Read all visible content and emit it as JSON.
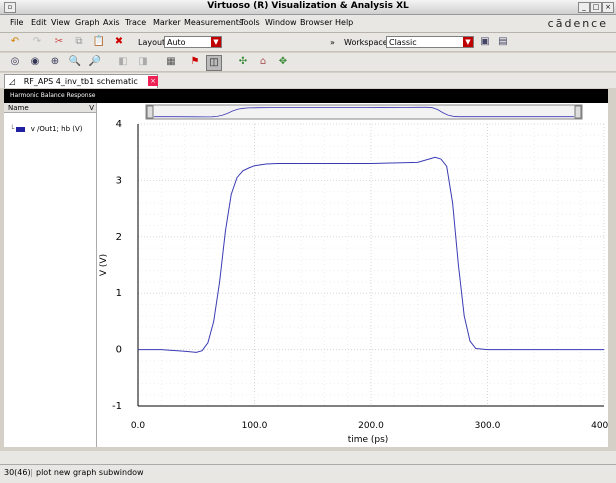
{
  "window": {
    "title": "Virtuoso (R) Visualization & Analysis XL"
  },
  "menu": [
    "File",
    "Edit",
    "View",
    "Graph",
    "Axis",
    "Trace",
    "Marker",
    "Measurements",
    "Tools",
    "Window",
    "Browser",
    "Help"
  ],
  "brand": "cādence",
  "toolbar": {
    "layout_label": "Layout:",
    "layout_value": "Auto",
    "workspace_label": "Workspace:",
    "workspace_value": "Classic"
  },
  "tab": {
    "label": "RF_APS 4_inv_tb1 schematic"
  },
  "graph": {
    "title": "Harmonic Balance Response"
  },
  "legend": {
    "header": "Name",
    "header_v": "V",
    "trace": "v /Out1; hb (V)"
  },
  "status": {
    "count": "30(46)",
    "message": "plot new graph subwindow"
  },
  "colors": {
    "trace": "#3b3bb5",
    "grid": "#d8d8d8"
  },
  "chart_data": {
    "type": "line",
    "xlabel": "time (ps)",
    "ylabel": "V (V)",
    "xlim": [
      0,
      400
    ],
    "ylim": [
      -1,
      4
    ],
    "xticks": [
      "0.0",
      "100.0",
      "200.0",
      "300.0",
      "400.0"
    ],
    "yticks": [
      "4",
      "3",
      "2",
      "1",
      "0",
      "-1"
    ],
    "grid": true,
    "series": [
      {
        "name": "v /Out1; hb (V)",
        "x": [
          0,
          20,
          40,
          50,
          55,
          60,
          65,
          70,
          75,
          80,
          85,
          90,
          95,
          100,
          110,
          120,
          150,
          200,
          240,
          250,
          255,
          260,
          265,
          270,
          275,
          280,
          285,
          290,
          300,
          350,
          400
        ],
        "y": [
          0,
          0,
          -0.03,
          -0.05,
          -0.02,
          0.12,
          0.5,
          1.2,
          2.1,
          2.75,
          3.05,
          3.17,
          3.22,
          3.26,
          3.29,
          3.3,
          3.3,
          3.3,
          3.32,
          3.38,
          3.41,
          3.38,
          3.25,
          2.6,
          1.5,
          0.6,
          0.15,
          0.02,
          0,
          0,
          0
        ]
      }
    ]
  }
}
